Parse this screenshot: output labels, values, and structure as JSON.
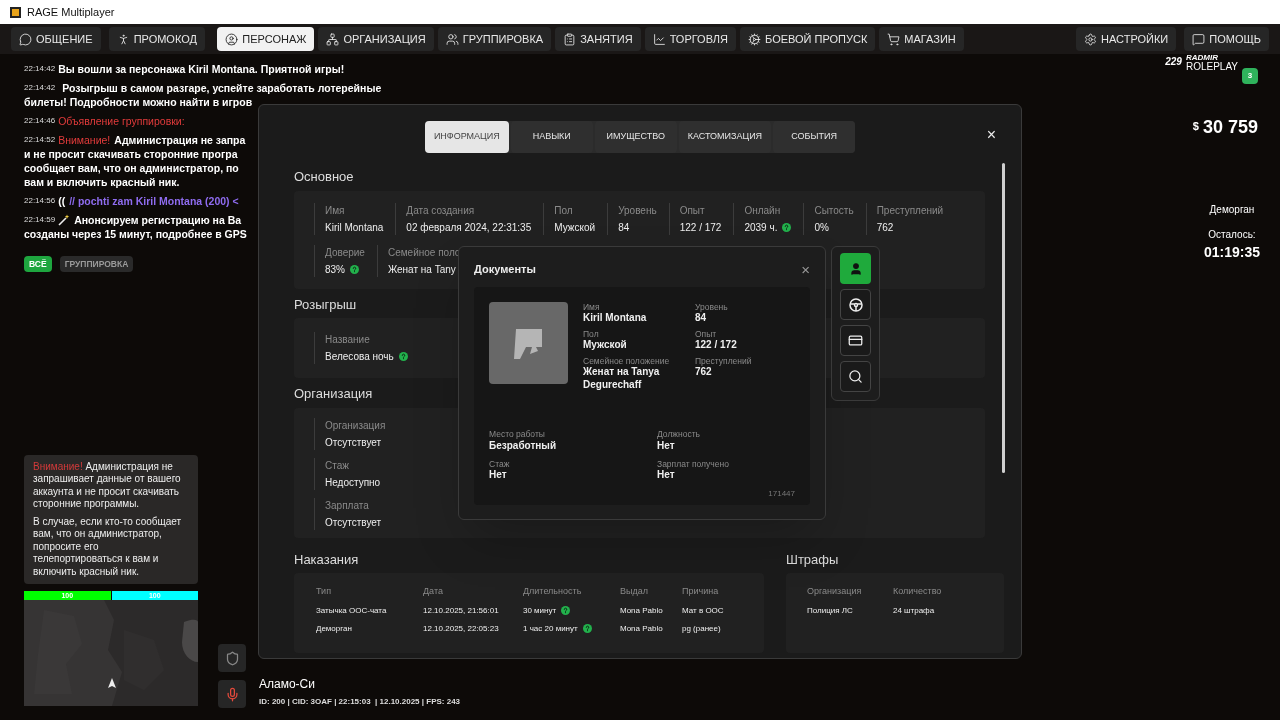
{
  "window": {
    "title": "RAGE Multiplayer"
  },
  "nav": {
    "left": [
      {
        "label": "ОБЩЕНИЕ",
        "selected": false
      },
      {
        "label": "ПРОМОКОД",
        "selected": false
      }
    ],
    "center": [
      {
        "label": "ПЕРСОНАЖ",
        "selected": true
      },
      {
        "label": "ОРГАНИЗАЦИЯ",
        "selected": false
      },
      {
        "label": "ГРУППИРОВКА",
        "selected": false
      },
      {
        "label": "ЗАНЯТИЯ",
        "selected": false
      },
      {
        "label": "ТОРГОВЛЯ",
        "selected": false
      },
      {
        "label": "БОЕВОЙ ПРОПУСК",
        "selected": false
      },
      {
        "label": "МАГАЗИН",
        "selected": false
      }
    ],
    "right": [
      {
        "label": "НАСТРОЙКИ",
        "selected": false
      },
      {
        "label": "ПОМОЩЬ",
        "selected": false
      }
    ]
  },
  "chat": [
    {
      "time": "22:14:42",
      "kind": "system",
      "lines": [
        "Вы вошли за персонажа Kiril Montana. Приятной игры!"
      ]
    },
    {
      "time": "22:14:42",
      "kind": "lottery",
      "lines": [
        "Розыгрыш в самом разгаре, успейте заработать лотерейные",
        "билеты! Подробности можно найти в игров"
      ]
    },
    {
      "time": "22:14:46",
      "kind": "alert",
      "prefix": "Объявление группировки:"
    },
    {
      "time": "22:14:52",
      "kind": "alert",
      "prefix": "Внимание!",
      "lines": [
        "Администрация не запра",
        "и не просит скачивать сторонние програ",
        "сообщает вам, что он администратор, по",
        "вам и включить красный ник."
      ]
    },
    {
      "time": "22:14:56",
      "kind": "ooc",
      "prefix": "((",
      "lines": [
        "// pochti zam Kiril Montana (200) <"
      ]
    },
    {
      "time": "22:14:59",
      "kind": "event",
      "lines": [
        "Анонсируем регистрацию на Ва",
        "созданы через 15 минут, подробнее в GPS"
      ]
    }
  ],
  "chat_filters": [
    {
      "label": "ВСЁ",
      "selected": true
    },
    {
      "label": "ГРУППИРОВКА",
      "selected": false
    }
  ],
  "notice": {
    "alert": "Внимание!",
    "text": "Администрация не запрашивает данные от вашего аккаунта и не просит скачивать сторонние программы.",
    "text_2": "В случае, если кто-то сообщает вам, что он администратор, попросите его телепортироваться к вам и включить красный ник."
  },
  "hud": {
    "bars": [
      {
        "value": "100",
        "level": 1,
        "color": "#00ff00"
      },
      {
        "value": "100",
        "level": 1,
        "color": "#00ffff"
      }
    ],
    "location": "Аламо-Си",
    "status": "ID: 200 | CID: 3OAF | 22:15:03  | 12.10.2025 | FPS: 243",
    "logo": {
      "online": "229",
      "name": "RADMIR",
      "sub": "ROLEPLAY",
      "server": "3"
    },
    "money": {
      "currency": "$",
      "amount": "30 759"
    },
    "jail": {
      "title": "Деморган",
      "label": "Осталось:",
      "time": "01:19:35"
    }
  },
  "modal": {
    "tabs": [
      {
        "label": "ИНФОРМАЦИЯ",
        "selected": true
      },
      {
        "label": "НАВЫКИ",
        "selected": false
      },
      {
        "label": "ИМУЩЕСТВО",
        "selected": false
      },
      {
        "label": "КАСТОМИЗАЦИЯ",
        "selected": false
      },
      {
        "label": "СОБЫТИЯ",
        "selected": false
      }
    ],
    "close": "×",
    "main": {
      "title": "Основное",
      "rows": [
        [
          {
            "label": "Имя",
            "value": "Kiril Montana"
          },
          {
            "label": "Дата создания",
            "value": "02 февраля 2024, 22:31:35"
          },
          {
            "label": "Пол",
            "value": "Мужской"
          },
          {
            "label": "Уровень",
            "value": "84"
          },
          {
            "label": "Опыт",
            "value": "122 / 172"
          },
          {
            "label": "Онлайн",
            "value": "2039 ч.",
            "info": true
          },
          {
            "label": "Сытость",
            "value": "0%"
          },
          {
            "label": "Преступлений",
            "value": "762"
          }
        ],
        [
          {
            "label": "Доверие",
            "value": "83%",
            "info": true
          },
          {
            "label": "Семейное поло",
            "value": "Женат на Tanу"
          }
        ]
      ]
    },
    "lottery": {
      "title": "Розыгрыш",
      "fields": [
        {
          "label": "Название",
          "value": "Велесова ночь",
          "info": true
        }
      ]
    },
    "organization": {
      "title": "Организация",
      "fields": [
        {
          "label": "Организация",
          "value": "Отсутствует"
        },
        {
          "label": "Стаж",
          "value": "Недоступно"
        },
        {
          "label": "Зарплата",
          "value": "Отсутствует"
        }
      ]
    },
    "punishments": {
      "title": "Наказания",
      "columns": [
        "Тип",
        "Дата",
        "Длительность",
        "Выдал",
        "Причина"
      ],
      "rows": [
        {
          "cells": [
            "Затычка ООС-чата",
            "12.10.2025, 21:56:01",
            "30 минут",
            "Mona Pablo",
            "Мат в ООС"
          ],
          "info": true
        },
        {
          "cells": [
            "Деморган",
            "12.10.2025, 22:05:23",
            "1 час 20 минут",
            "Mona Pablo",
            "pg (ранее)"
          ],
          "info": true
        }
      ]
    },
    "fines": {
      "title": "Штрафы",
      "columns": [
        "Организация",
        "Количество"
      ],
      "rows": [
        [
          "Полиция ЛС",
          "24 штрафа"
        ]
      ]
    }
  },
  "documents": {
    "title": "Документы",
    "close": "×",
    "fields": [
      {
        "label": "Имя",
        "value": "Kiril Montana"
      },
      {
        "label": "Уровень",
        "value": "84"
      },
      {
        "label": "Пол",
        "value": "Мужской"
      },
      {
        "label": "Опыт",
        "value": "122 / 172"
      },
      {
        "label": "Семейное положение",
        "value": "Женат на Tanya Degurechaff"
      },
      {
        "label": "Преступлений",
        "value": "762"
      }
    ],
    "work": [
      {
        "label": "Место работы",
        "value": "Безработный"
      },
      {
        "label": "Должность",
        "value": "Нет"
      },
      {
        "label": "Стаж",
        "value": "Нет"
      },
      {
        "label": "Зарплат получено",
        "value": "Нет"
      }
    ],
    "number": "171447",
    "side_buttons": [
      {
        "selected": true
      },
      {
        "selected": false
      },
      {
        "selected": false
      },
      {
        "selected": false
      }
    ]
  }
}
